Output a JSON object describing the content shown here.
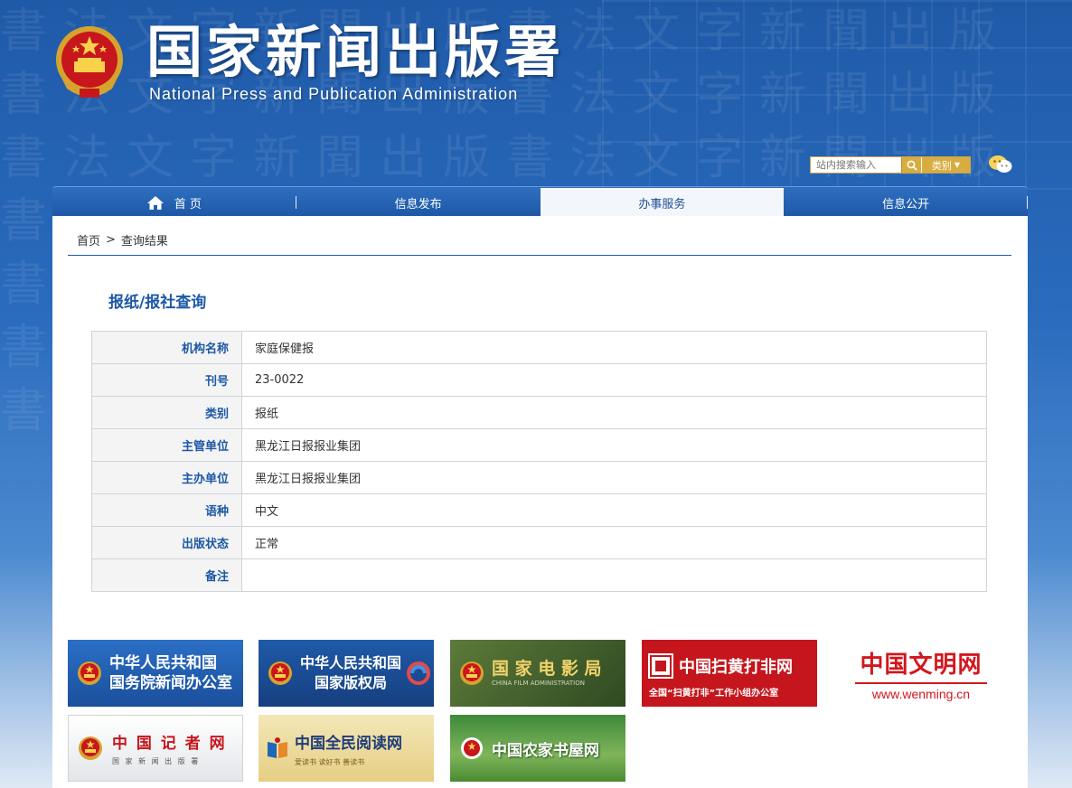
{
  "site": {
    "title": "国家新闻出版署",
    "subtitle": "National Press and Publication Administration"
  },
  "search": {
    "placeholder": "站内搜索输入",
    "category_label": "类别"
  },
  "nav": {
    "items": [
      {
        "label": "首 页"
      },
      {
        "label": "信息发布"
      },
      {
        "label": "办事服务"
      },
      {
        "label": "信息公开"
      }
    ]
  },
  "breadcrumb": {
    "home": "首页",
    "separator": ">",
    "current": "查询结果"
  },
  "section": {
    "title": "报纸/报社查询"
  },
  "details": {
    "rows": [
      {
        "label": "机构名称",
        "value": "家庭保健报"
      },
      {
        "label": "刊号",
        "value": "23-0022"
      },
      {
        "label": "类别",
        "value": "报纸"
      },
      {
        "label": "主管单位",
        "value": "黑龙江日报报业集团"
      },
      {
        "label": "主办单位",
        "value": "黑龙江日报报业集团"
      },
      {
        "label": "语种",
        "value": "中文"
      },
      {
        "label": "出版状态",
        "value": "正常"
      },
      {
        "label": "备注",
        "value": ""
      }
    ]
  },
  "links": {
    "scio": {
      "line1": "中华人民共和国",
      "line2": "国务院新闻办公室"
    },
    "ncac": {
      "line1": "中华人民共和国",
      "line2": "国家版权局"
    },
    "film": {
      "line1": "国 家 电 影 局",
      "line2": "CHINA FILM ADMINISTRATION"
    },
    "shdf": {
      "line1": "中国扫黄打非网",
      "line2": "全国“扫黄打非”工作小组办公室"
    },
    "wenming": {
      "line1": "中国文明网",
      "line2": "www.wenming.cn"
    },
    "jizhe": {
      "line1": "中 国 记 者 网",
      "line2": "国 家 新 闻 出 版 署"
    },
    "read": {
      "line1": "中国全民阅读网",
      "line2": "爱读书  读好书  善读书"
    },
    "farm": {
      "line1": "中国农家书屋网"
    }
  },
  "colors": {
    "brand_blue": "#1d58a6",
    "accent_gold": "#d7ad3f"
  }
}
